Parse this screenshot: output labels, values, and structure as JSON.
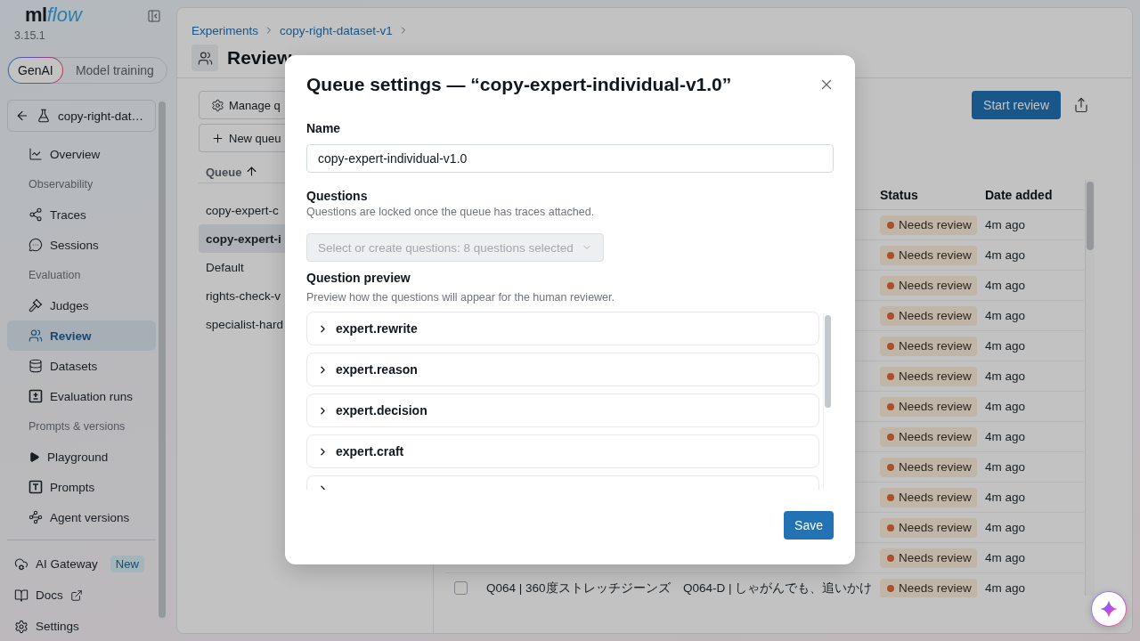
{
  "sidebar": {
    "logo": {
      "text": "ml",
      "accent": "flow"
    },
    "version": "3.15.1",
    "modes": [
      {
        "label": "GenAI",
        "selected": true
      },
      {
        "label": "Model training",
        "selected": false
      }
    ],
    "experiment": "copy-right-dat…",
    "nav": [
      {
        "kind": "link",
        "label": "Overview",
        "selected": false
      },
      {
        "kind": "section",
        "label": "Observability"
      },
      {
        "kind": "link",
        "label": "Traces",
        "selected": false
      },
      {
        "kind": "link",
        "label": "Sessions",
        "selected": false
      },
      {
        "kind": "section",
        "label": "Evaluation"
      },
      {
        "kind": "link",
        "label": "Judges",
        "selected": false
      },
      {
        "kind": "link",
        "label": "Review",
        "selected": true
      },
      {
        "kind": "link",
        "label": "Datasets",
        "selected": false
      },
      {
        "kind": "link",
        "label": "Evaluation runs",
        "selected": false
      },
      {
        "kind": "section",
        "label": "Prompts & versions"
      },
      {
        "kind": "link",
        "label": "Playground",
        "selected": false
      },
      {
        "kind": "link",
        "label": "Prompts",
        "selected": false
      },
      {
        "kind": "link",
        "label": "Agent versions",
        "selected": false
      }
    ],
    "footer": [
      {
        "label": "AI Gateway",
        "badge": "New",
        "external": false
      },
      {
        "label": "Docs",
        "external": true
      },
      {
        "label": "Settings",
        "external": false
      }
    ]
  },
  "breadcrumb": [
    "Experiments",
    "copy-right-dataset-v1"
  ],
  "page": {
    "title": "Review"
  },
  "queues": {
    "buttons": [
      "Manage q",
      "New queu"
    ],
    "column": "Queue",
    "sorted_ascending": true,
    "items": [
      {
        "label": "copy-expert-c",
        "selected": false
      },
      {
        "label": "copy-expert-i",
        "selected": true
      },
      {
        "label": "Default",
        "selected": false
      },
      {
        "label": "rights-check-v",
        "selected": false
      },
      {
        "label": "specialist-hard",
        "selected": false
      }
    ]
  },
  "toolbar": {
    "primary": "Start review"
  },
  "table": {
    "columns": [
      "Status",
      "Date added"
    ],
    "rows": [
      {
        "status": "Needs review",
        "date_added": "4m ago"
      },
      {
        "status": "Needs review",
        "date_added": "4m ago"
      },
      {
        "status": "Needs review",
        "date_added": "4m ago"
      },
      {
        "status": "Needs review",
        "date_added": "4m ago"
      },
      {
        "status": "Needs review",
        "date_added": "4m ago"
      },
      {
        "status": "Needs review",
        "date_added": "4m ago"
      },
      {
        "status": "Needs review",
        "date_added": "4m ago"
      },
      {
        "status": "Needs review",
        "date_added": "4m ago"
      },
      {
        "status": "Needs review",
        "date_added": "4m ago"
      },
      {
        "status": "Needs review",
        "date_added": "4m ago"
      },
      {
        "status": "Needs review",
        "date_added": "4m ago"
      },
      {
        "status": "Needs review",
        "date_added": "4m ago"
      },
      {
        "checked": false,
        "column_1": "Q064 | 360度ストレッチジーンズ",
        "column_2": "Q064-D | しゃがんでも、追いかけ",
        "status": "Needs review",
        "date_added": "4m ago"
      }
    ]
  },
  "dialog": {
    "title": "Queue settings — “copy-expert-individual-v1.0”",
    "name_label": "Name",
    "name_value": "copy-expert-individual-v1.0",
    "questions_label": "Questions",
    "questions_help": "Questions are locked once the queue has traces attached.",
    "questions_select": {
      "value": "Select or create questions: 8 questions selected",
      "disabled": true
    },
    "preview_label": "Question preview",
    "preview_help": "Preview how the questions will appear for the human reviewer.",
    "questions": [
      {
        "label": "expert.rewrite",
        "expanded": false
      },
      {
        "label": "expert.reason",
        "expanded": false
      },
      {
        "label": "expert.decision",
        "expanded": false
      },
      {
        "label": "expert.craft",
        "expanded": false
      },
      {
        "expanded": false
      }
    ],
    "save": "Save"
  }
}
